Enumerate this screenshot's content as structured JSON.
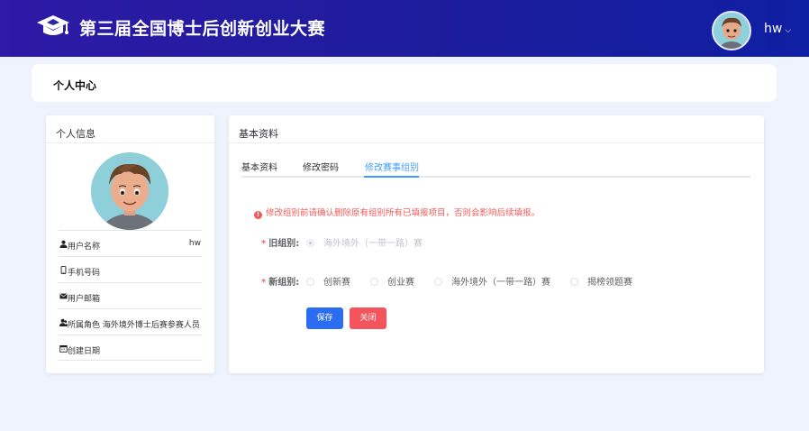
{
  "header": {
    "site_title": "第三届全国博士后创新创业大赛",
    "username": "hw",
    "caret": "⌵"
  },
  "breadcrumb": {
    "title": "个人中心"
  },
  "profile": {
    "card_title": "个人信息",
    "rows": [
      {
        "icon": "user-icon",
        "label": "用户名称",
        "value": "hw"
      },
      {
        "icon": "phone-icon",
        "label": "手机号码",
        "value": ""
      },
      {
        "icon": "mail-icon",
        "label": "用户邮箱",
        "value": ""
      },
      {
        "icon": "role-icon",
        "label": "所属角色",
        "value": "海外境外博士后赛参赛人员"
      },
      {
        "icon": "calendar-icon",
        "label": "创建日期",
        "value": ""
      }
    ]
  },
  "main": {
    "card_title": "基本资料",
    "tabs": [
      {
        "label": "基本资料",
        "active": false
      },
      {
        "label": "修改密码",
        "active": false
      },
      {
        "label": "修改赛事组别",
        "active": true
      }
    ],
    "warning": "修改组别前请确认删除原有组别所有已填报项目，否则会影响后续填报。",
    "warning_icon": "!",
    "old_group": {
      "label": "旧组别:",
      "required_mark": "*",
      "options": [
        "海外境外（一带一路）赛"
      ],
      "selected": "海外境外（一带一路）赛",
      "disabled": true
    },
    "new_group": {
      "label": "新组别:",
      "required_mark": "*",
      "options": [
        "创新赛",
        "创业赛",
        "海外境外（一带一路）赛",
        "揭榜领题赛"
      ]
    },
    "save_label": "保存",
    "close_label": "关闭"
  },
  "colors": {
    "header": "#1d1d9c",
    "accent": "#409eff",
    "danger": "#f25a5a",
    "primary_button": "#2b6df1",
    "close_button": "#f4545b"
  }
}
